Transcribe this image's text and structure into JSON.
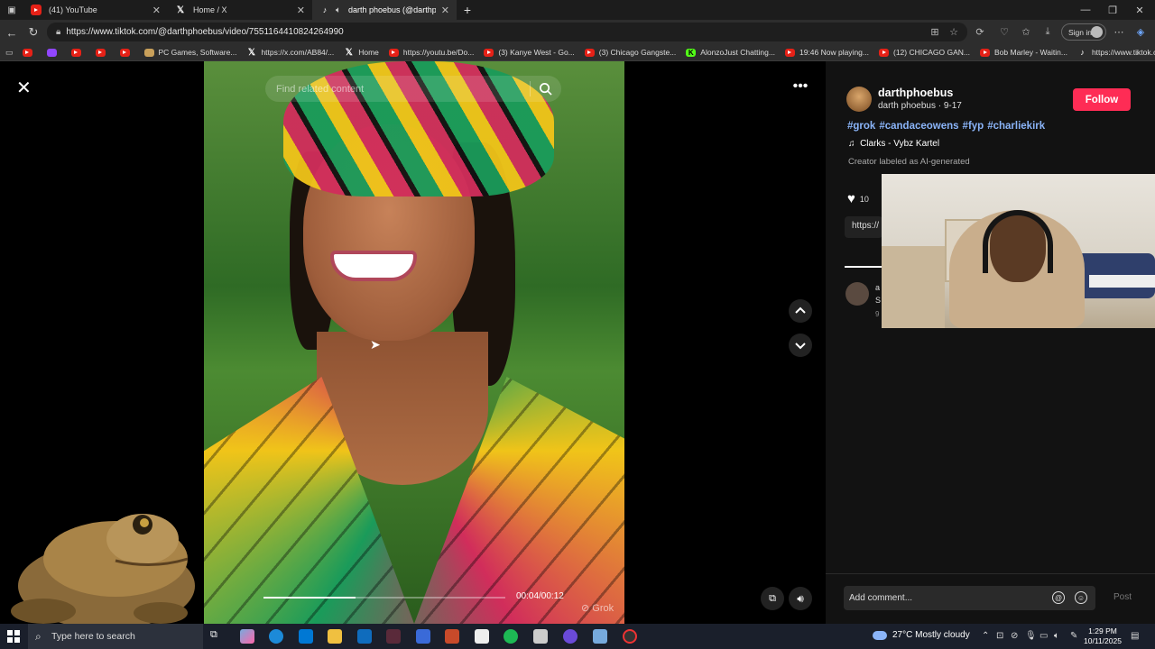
{
  "browser": {
    "tabs": [
      {
        "title": "(41) YouTube",
        "icon": "youtube-icon",
        "active": false
      },
      {
        "title": "Home / X",
        "icon": "x-icon",
        "active": false
      },
      {
        "title": "darth phoebus (@darthphoe",
        "icon": "tiktok-icon",
        "active": true
      }
    ],
    "url": "https://www.tiktok.com/@darthphoebus/video/7551164410824264990",
    "sign_in": "Sign in",
    "bookmarks": [
      {
        "label": "",
        "icon": "youtube-icon"
      },
      {
        "label": "",
        "icon": "twitch-icon"
      },
      {
        "label": "",
        "icon": "youtube-icon"
      },
      {
        "label": "",
        "icon": "youtube-icon"
      },
      {
        "label": "",
        "icon": "youtube-icon"
      },
      {
        "label": "PC Games, Software...",
        "icon": "site-icon"
      },
      {
        "label": "https://x.com/AB84/...",
        "icon": "x-icon"
      },
      {
        "label": "Home",
        "icon": "x-icon"
      },
      {
        "label": "https://youtu.be/Do...",
        "icon": "youtube-icon"
      },
      {
        "label": "(3) Kanye West - Go...",
        "icon": "youtube-icon"
      },
      {
        "label": "(3) Chicago Gangste...",
        "icon": "youtube-icon"
      },
      {
        "label": "AlonzoJust Chatting...",
        "icon": "kick-icon"
      },
      {
        "label": "19:46 Now playing...",
        "icon": "youtube-icon"
      },
      {
        "label": "(12) CHICAGO GAN...",
        "icon": "youtube-icon"
      },
      {
        "label": "Bob Marley - Waitin...",
        "icon": "youtube-icon"
      },
      {
        "label": "https://www.tiktok.c...",
        "icon": "tiktok-icon"
      }
    ]
  },
  "player": {
    "search_placeholder": "Find related content",
    "time": "00:04/00:12",
    "progress": 0.38,
    "watermark": "Grok"
  },
  "side": {
    "username": "darthphoebus",
    "subline": "darth phoebus · 9-17",
    "follow": "Follow",
    "hashtags": [
      "#grok",
      "#candaceowens",
      "#fyp",
      "#charliekirk"
    ],
    "music": "Clarks - Vybz Kartel",
    "ai_label": "Creator labeled as AI-generated",
    "likes": "10",
    "link": "https://",
    "comment_preview": [
      "a",
      "S",
      "9"
    ],
    "comment_placeholder": "Add comment...",
    "post": "Post"
  },
  "taskbar": {
    "search": "Type here to search",
    "weather": "27°C  Mostly cloudy",
    "time": "1:29 PM",
    "date": "10/11/2025"
  },
  "colors": {
    "follow": "#fe2c55",
    "hashtag": "#8ab4f8"
  }
}
